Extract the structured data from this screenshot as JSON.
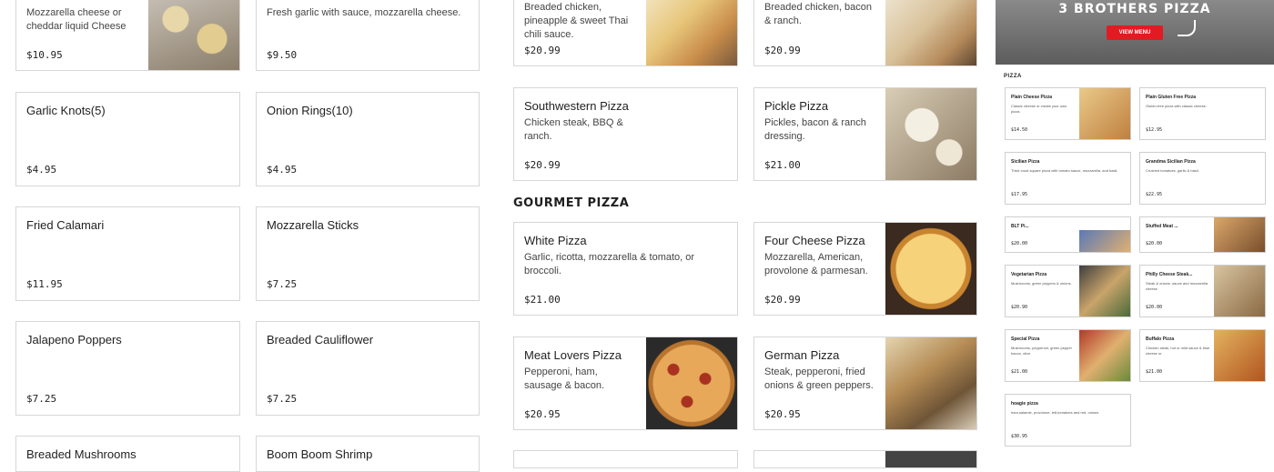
{
  "left_column_a": [
    {
      "desc": "Mozzarella cheese or cheddar liquid Cheese",
      "price": "$10.95"
    },
    {
      "title": "Garlic Knots(5)",
      "price": "$4.95"
    },
    {
      "title": "Fried Calamari",
      "price": "$11.95"
    },
    {
      "title": "Jalapeno Poppers",
      "price": "$7.25"
    },
    {
      "title": "Breaded Mushrooms"
    }
  ],
  "left_column_b": [
    {
      "desc": "Fresh garlic with sauce, mozzarella cheese.",
      "price": "$9.50"
    },
    {
      "title": "Onion Rings(10)",
      "price": "$4.95"
    },
    {
      "title": "Mozzarella Sticks",
      "price": "$7.25"
    },
    {
      "title": "Breaded Cauliflower",
      "price": "$7.25"
    },
    {
      "title": "Boom Boom Shrimp"
    }
  ],
  "specialty_col_a": [
    {
      "desc": "Breaded chicken, pineapple & sweet Thai chili sauce.",
      "price": "$20.99"
    },
    {
      "title": "Southwestern Pizza",
      "desc": "Chicken steak, BBQ & ranch.",
      "price": "$20.99"
    }
  ],
  "specialty_col_b": [
    {
      "desc": "Breaded chicken, bacon & ranch.",
      "price": "$20.99"
    },
    {
      "title": "Pickle Pizza",
      "desc": "Pickles, bacon & ranch dressing.",
      "price": "$21.00"
    }
  ],
  "gourmet_heading": "GOURMET PIZZA",
  "gourmet_col_a": [
    {
      "title": "White Pizza",
      "desc": "Garlic, ricotta, mozzarella & tomato, or broccoli.",
      "price": "$21.00"
    },
    {
      "title": "Meat Lovers Pizza",
      "desc": "Pepperoni, ham, sausage & bacon.",
      "price": "$20.95"
    }
  ],
  "gourmet_col_b": [
    {
      "title": "Four Cheese Pizza",
      "desc": "Mozzarella, American, provolone & parmesan.",
      "price": "$20.99"
    },
    {
      "title": "German Pizza",
      "desc": "Steak, pepperoni, fried onions & green peppers.",
      "price": "$20.95"
    }
  ],
  "preview": {
    "banner_title": "3 BROTHERS PIZZA",
    "banner_button": "VIEW MENU",
    "section_label": "PIZZA",
    "items": [
      {
        "title": "Plain Cheese Pizza",
        "desc": "Classic cheese or create your own pizza.",
        "price": "$14.50"
      },
      {
        "title": "Plain Gluten Free Pizza",
        "desc": "Gluten-free pizza with classic cheese.",
        "price": "$12.95"
      },
      {
        "title": "Sicilian Pizza",
        "desc": "Thick crust square pizza with tomato sauce, mozzarella, and basil.",
        "price": "$17.95"
      },
      {
        "title": "Grandma Sicilian Pizza",
        "desc": "Crushed tomatoes, garlic & basil.",
        "price": "$22.95"
      },
      {
        "title": "BLT Pi...",
        "desc": "",
        "price": "$20.00"
      },
      {
        "title": "Stuffed Meat ...",
        "desc": "",
        "price": "$20.00"
      },
      {
        "title": "Vegetarian Pizza",
        "desc": "Mushrooms, green peppers & onions.",
        "price": "$20.90"
      },
      {
        "title": "Philly Cheese Steak...",
        "desc": "Steak & onions ,sauce and mozzarella cheese",
        "price": "$20.00"
      },
      {
        "title": "Special Pizza",
        "desc": "Mushrooms, pepperoni, green pepper bacon, olive",
        "price": "$21.00"
      },
      {
        "title": "Buffalo Pizza",
        "desc": "Chicken steak, hot or mild sauce & blue cheese or",
        "price": "$21.00"
      },
      {
        "title": "hoagie pizza",
        "desc": "ham,salamie, provolone, lett,tomatoes and red. onions",
        "price": "$30.95"
      }
    ]
  },
  "colors": {
    "border": "#d7d7d7",
    "banner_red": "#e21b23",
    "banner_bg": "#6b6b6b"
  }
}
